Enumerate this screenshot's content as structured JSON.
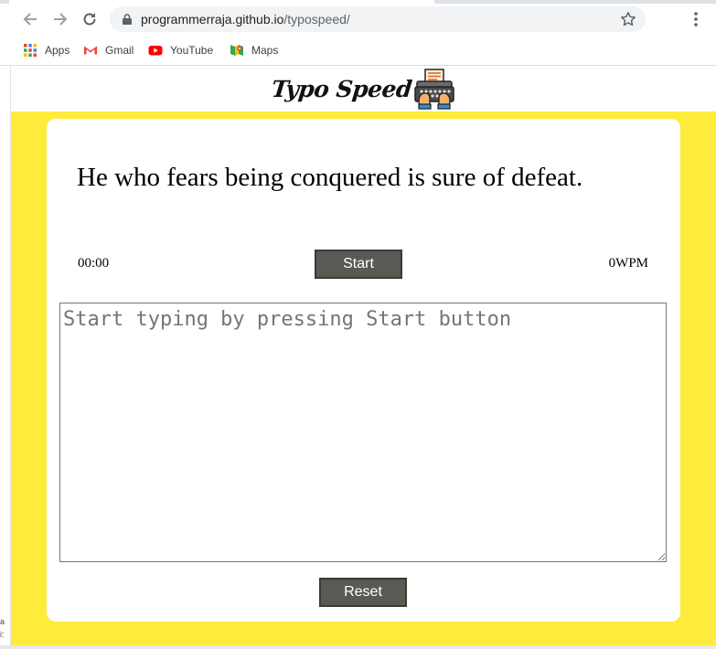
{
  "browser": {
    "url_host": "programmerraja.github.io",
    "url_path": "/typospeed/",
    "bookmarks": [
      {
        "label": "Apps",
        "icon": "apps-grid-icon"
      },
      {
        "label": "Gmail",
        "icon": "gmail-icon"
      },
      {
        "label": "YouTube",
        "icon": "youtube-icon"
      },
      {
        "label": "Maps",
        "icon": "maps-icon"
      }
    ]
  },
  "left_edge_fragments": [
    "a",
    "i:"
  ],
  "page": {
    "logo_text": "Typo Speed",
    "quote": "He who fears being conquered is sure of defeat.",
    "timer": "00:00",
    "wpm": "0WPM",
    "start_label": "Start",
    "reset_label": "Reset",
    "input_placeholder": "Start typing by pressing Start button"
  },
  "colors": {
    "background_yellow": "#ffeb3b",
    "button_gray": "#5a5a55",
    "card_white": "#ffffff"
  }
}
